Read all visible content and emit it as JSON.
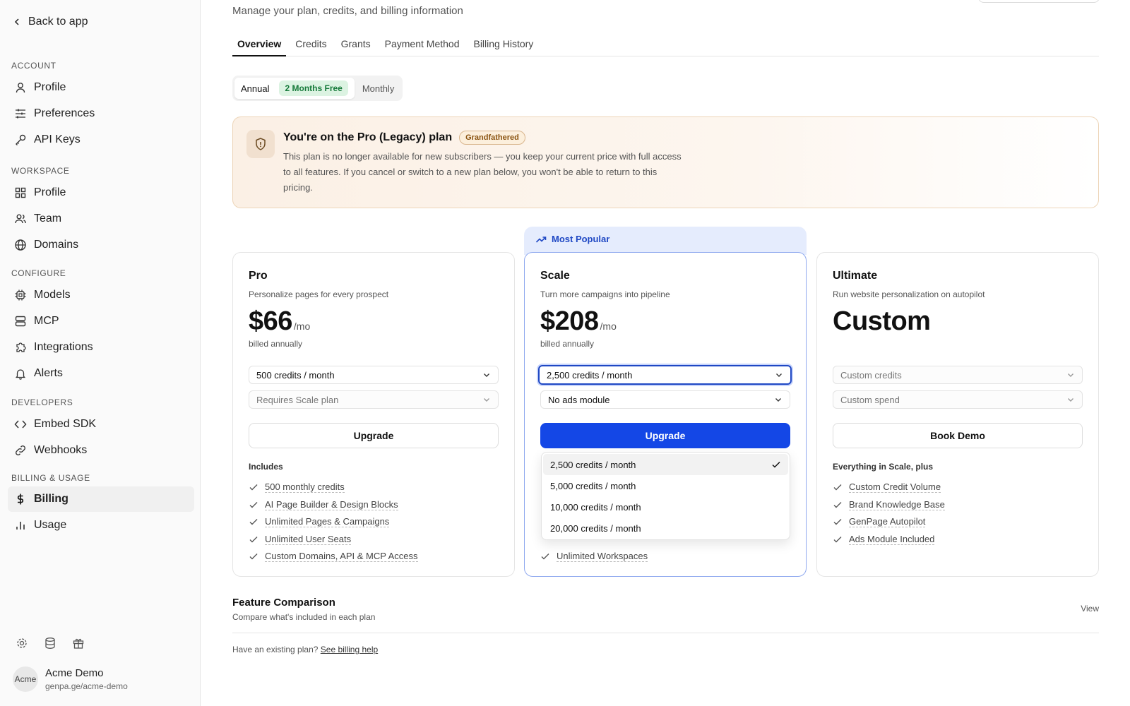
{
  "sidebar": {
    "back_label": "Back to app",
    "sections": {
      "account": "ACCOUNT",
      "workspace": "WORKSPACE",
      "configure": "CONFIGURE",
      "developers": "DEVELOPERS",
      "billing": "BILLING & USAGE"
    },
    "items": {
      "profile": "Profile",
      "preferences": "Preferences",
      "api_keys": "API Keys",
      "ws_profile": "Profile",
      "team": "Team",
      "domains": "Domains",
      "models": "Models",
      "mcp": "MCP",
      "integrations": "Integrations",
      "alerts": "Alerts",
      "embed_sdk": "Embed SDK",
      "webhooks": "Webhooks",
      "billing": "Billing",
      "usage": "Usage"
    },
    "user": {
      "name": "Acme Demo",
      "url": "genpa.ge/acme-demo",
      "avatar_alt": "Acme"
    }
  },
  "header": {
    "subtitle": "Manage your plan, credits, and billing information"
  },
  "tabs": [
    "Overview",
    "Credits",
    "Grants",
    "Payment Method",
    "Billing History"
  ],
  "billing_toggle": {
    "annual": "Annual",
    "free_badge": "2 Months Free",
    "monthly": "Monthly",
    "selected": "Annual"
  },
  "legacy": {
    "title": "You're on the Pro (Legacy) plan",
    "badge": "Grandfathered",
    "description": "This plan is no longer available for new subscribers — you keep your current price with full access to all features. If you cancel or switch to a new plan below, you won't be able to return to this pricing."
  },
  "popular_label": "Most Popular",
  "plans": {
    "pro": {
      "name": "Pro",
      "description": "Personalize pages for every prospect",
      "price": "$66",
      "per": "/mo",
      "billed": "billed annually",
      "credits_select": "500 credits / month",
      "addon_select": "Requires Scale plan",
      "button": "Upgrade",
      "includes_label": "Includes",
      "features": [
        "500 monthly credits",
        "AI Page Builder & Design Blocks",
        "Unlimited Pages & Campaigns",
        "Unlimited User Seats",
        "Custom Domains, API & MCP Access"
      ]
    },
    "scale": {
      "name": "Scale",
      "description": "Turn more campaigns into pipeline",
      "price": "$208",
      "per": "/mo",
      "billed": "billed annually",
      "credits_select": "2,500 credits / month",
      "addon_select": "No ads module",
      "button": "Upgrade",
      "features_visible": [
        "Unlimited Workspaces"
      ]
    },
    "ultimate": {
      "name": "Ultimate",
      "description": "Run website personalization on autopilot",
      "price": "Custom",
      "credits_select": "Custom credits",
      "addon_select": "Custom spend",
      "button": "Book Demo",
      "includes_label": "Everything in Scale, plus",
      "features": [
        "Custom Credit Volume",
        "Brand Knowledge Base",
        "GenPage Autopilot",
        "Ads Module Included"
      ]
    }
  },
  "credits_dropdown": {
    "options": [
      "2,500 credits / month",
      "5,000 credits / month",
      "10,000 credits / month",
      "20,000 credits / month"
    ],
    "selected": "2,500 credits / month"
  },
  "feature_comparison": {
    "title": "Feature Comparison",
    "description": "Compare what's included in each plan",
    "view_label": "View"
  },
  "help": {
    "text": "Have an existing plan?",
    "link": "See billing help"
  }
}
